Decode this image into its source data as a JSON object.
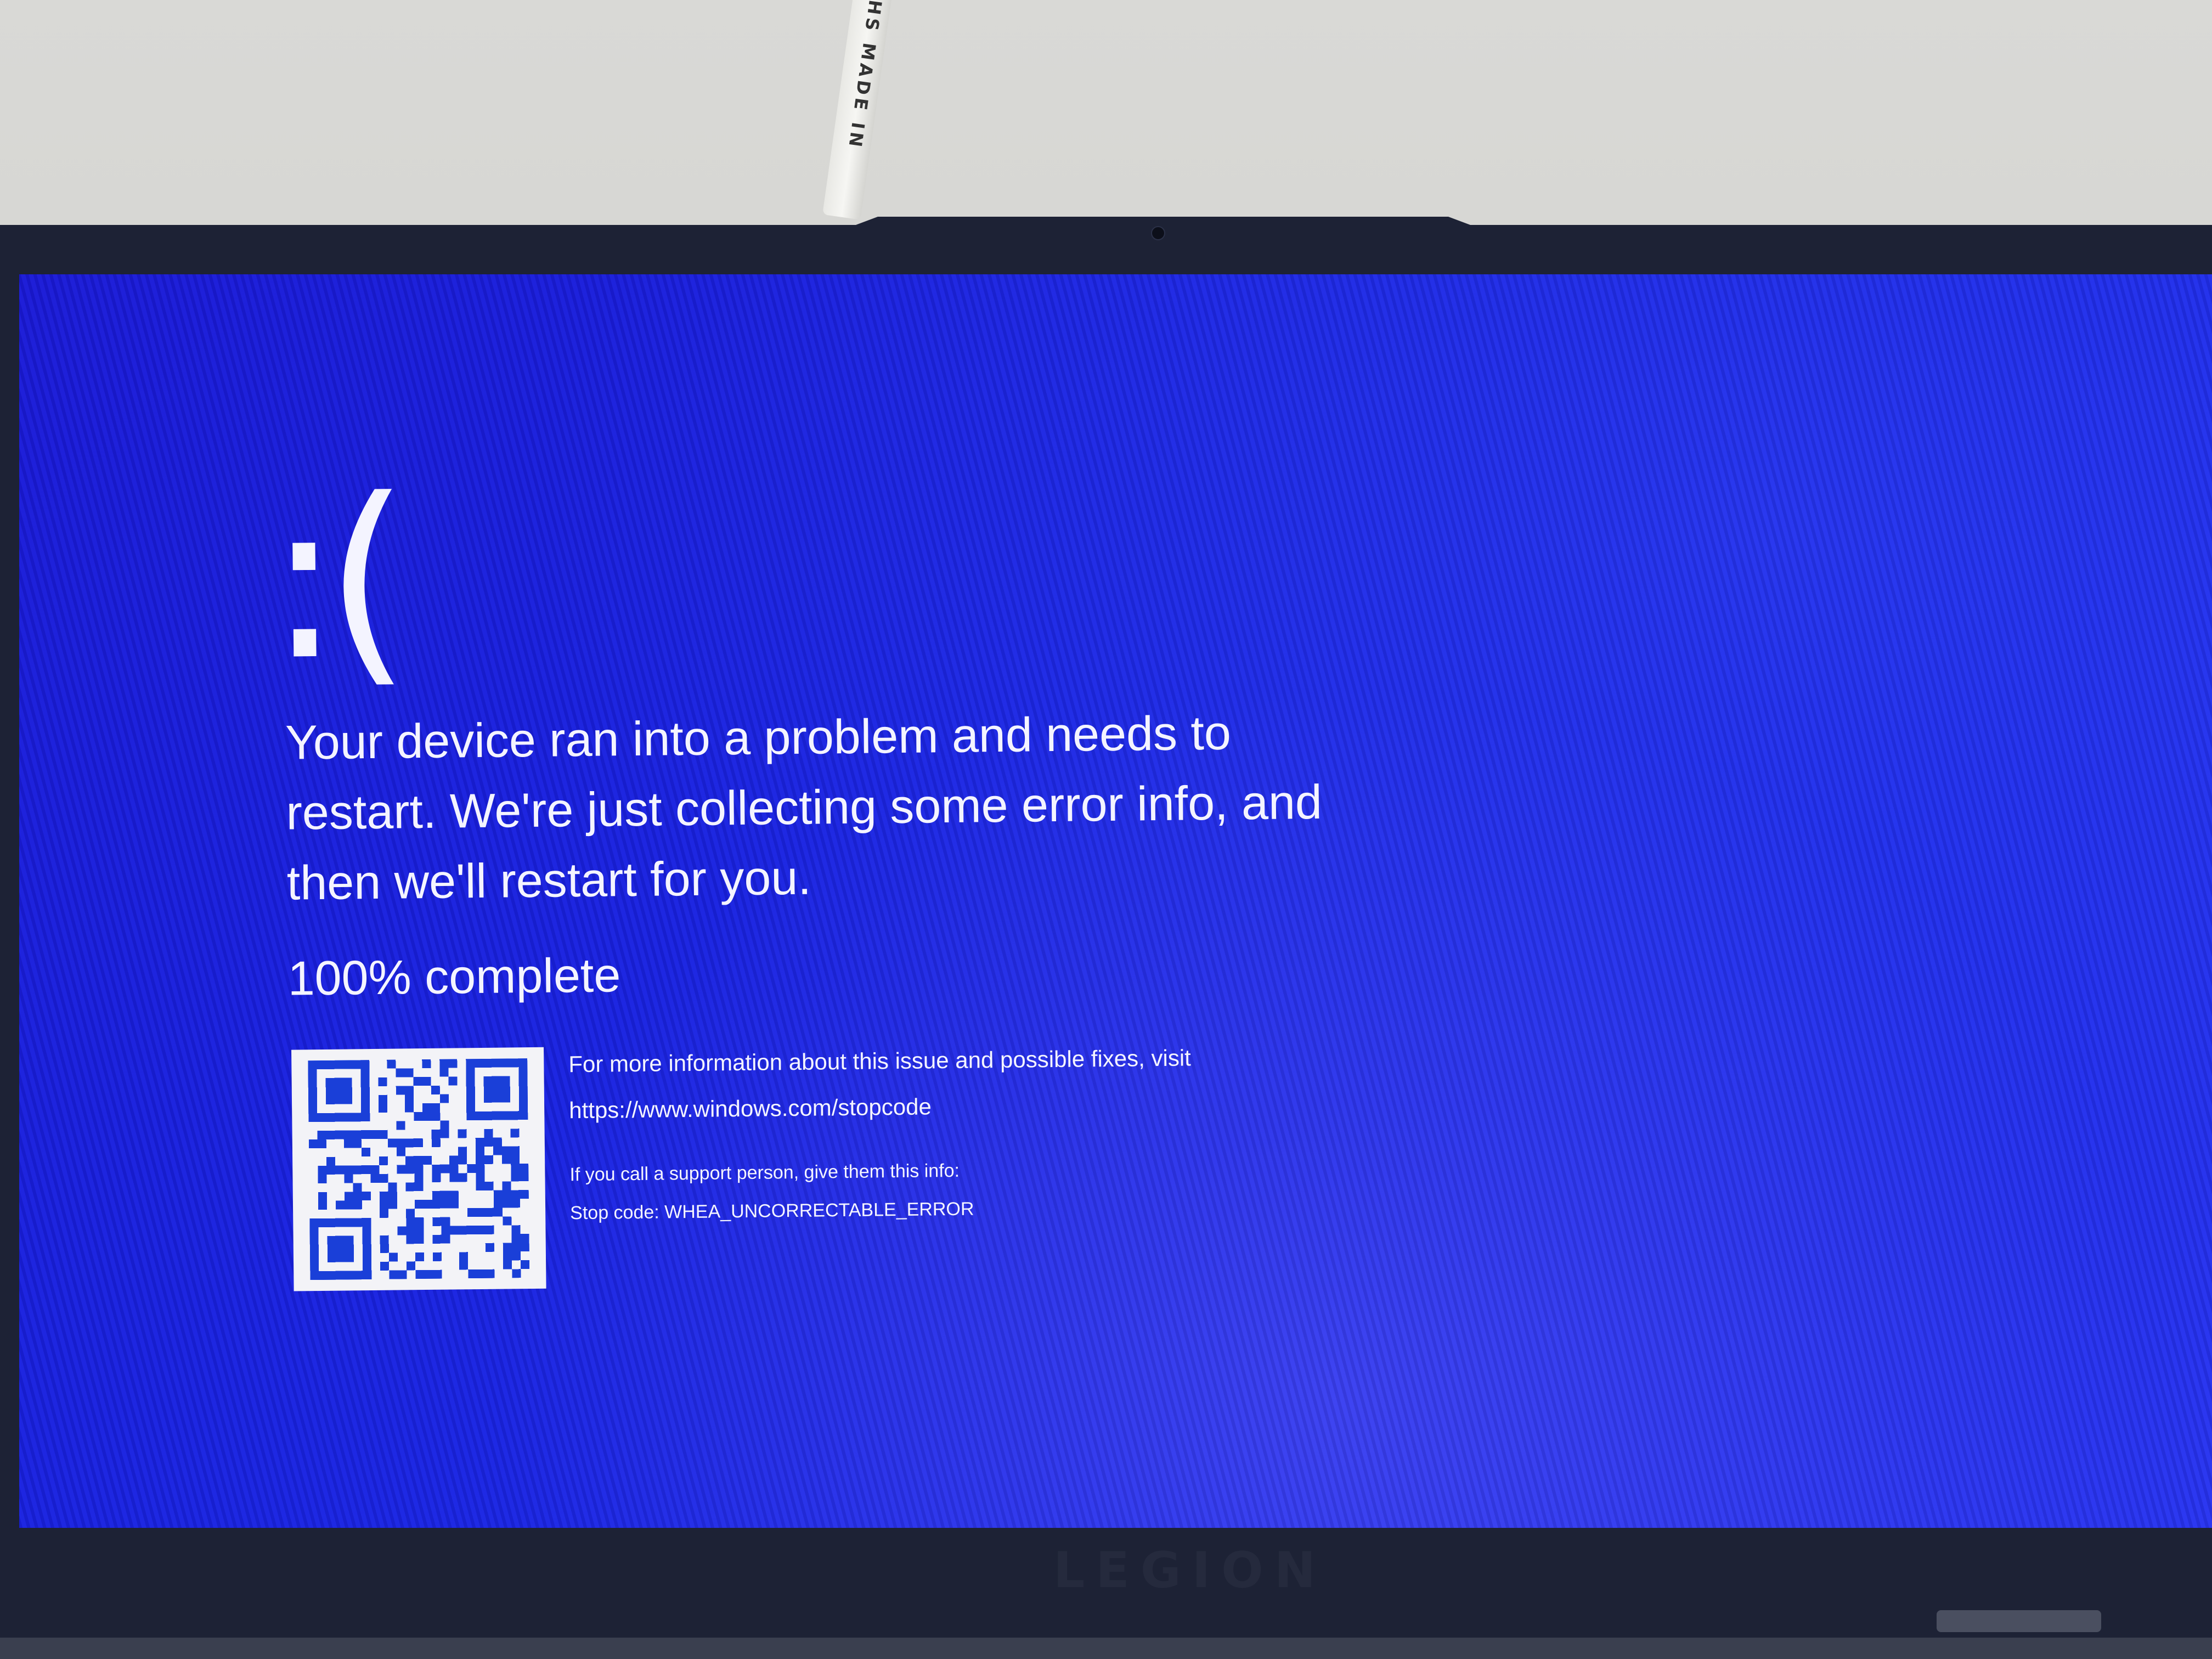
{
  "environment": {
    "cable_label": "HS MADE IN",
    "brand_logo": "LEGION"
  },
  "crash_screen": {
    "sad_face": ":(",
    "message": "Your device ran into a problem and needs to restart. We're just collecting some error info, and then we'll restart for you.",
    "progress_percent": 100,
    "progress_text": "100% complete",
    "info_line_1": "For more information about this issue and possible fixes, visit",
    "info_url": "https://www.windows.com/stopcode",
    "support_line": "If you call a support person, give them this info:",
    "stop_code_line": "Stop code: WHEA_UNCORRECTABLE_ERROR",
    "qr_icon": "qr-code-icon"
  },
  "colors": {
    "screen_blue": "#1b1ad6",
    "text": "#f4f4ff",
    "qr_dark": "#1a3fd8",
    "qr_light": "#f3f3f7"
  }
}
